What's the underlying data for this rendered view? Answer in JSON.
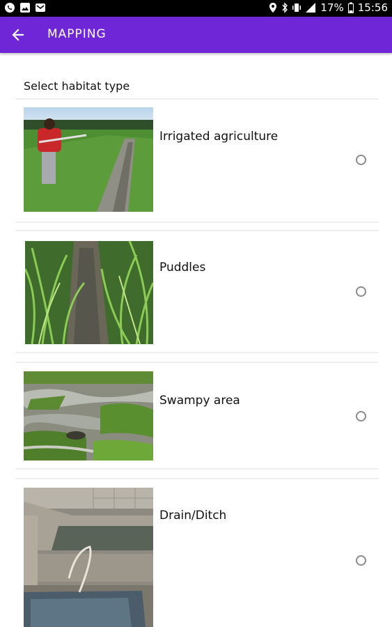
{
  "status_bar": {
    "battery": "17%",
    "time": "15:56",
    "left_icons": [
      "whatsapp-icon",
      "image-icon",
      "gmail-icon"
    ],
    "right_icons": [
      "location-icon",
      "bluetooth-icon",
      "vibrate-icon",
      "signal-icon",
      "battery-icon"
    ]
  },
  "app_bar": {
    "title": "MAPPING",
    "back_icon": "arrow-left-icon",
    "color": "#6f26d6"
  },
  "prompt": "Select habitat type",
  "options": [
    {
      "label": "Irrigated agriculture",
      "selected": false
    },
    {
      "label": "Puddles",
      "selected": false
    },
    {
      "label": "Swampy area",
      "selected": false
    },
    {
      "label": "Drain/Ditch",
      "selected": false
    }
  ]
}
